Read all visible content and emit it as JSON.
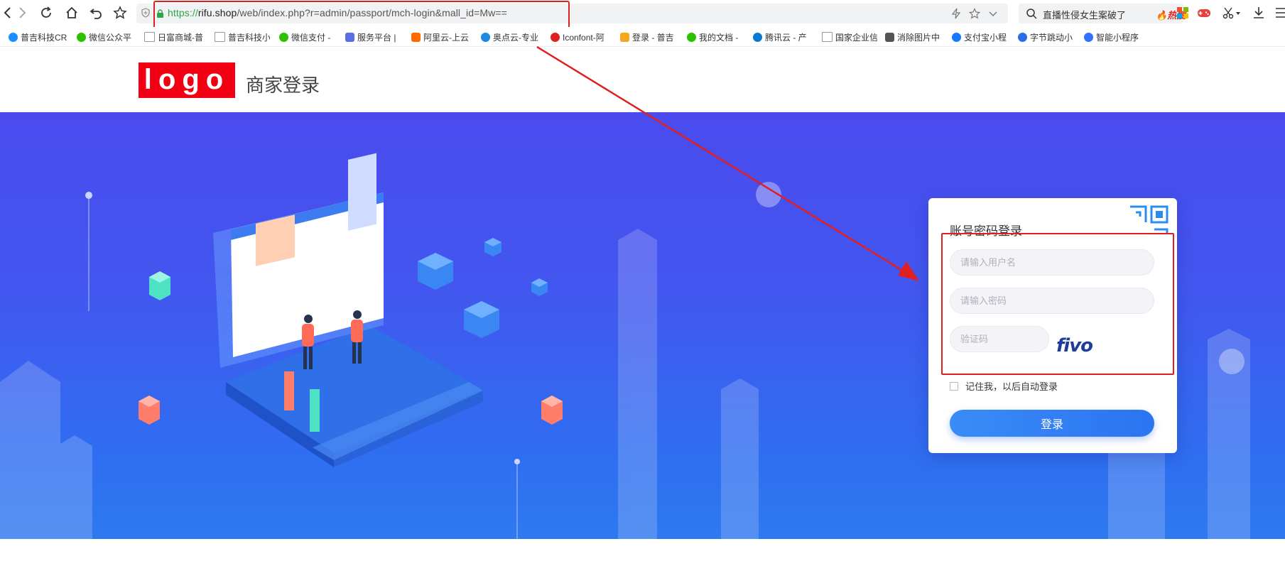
{
  "browser": {
    "url_protocol": "https://",
    "url_host": "rifu.shop",
    "url_path": "/web/index.php?r=admin/passport/mch-login&mall_id=Mw==",
    "search_text": "直播性侵女生案破了",
    "search_badge": "🔥热搜"
  },
  "bookmarks": [
    {
      "label": "普吉科技CR",
      "color": "#1890ff"
    },
    {
      "label": "微信公众平",
      "color": "#2dc100"
    },
    {
      "label": "日富商城-普",
      "color": "#999999"
    },
    {
      "label": "普吉科技小",
      "color": "#999999"
    },
    {
      "label": "微信支付 -",
      "color": "#2dc100"
    },
    {
      "label": "服务平台 |",
      "color": "#5b6ee1"
    },
    {
      "label": "阿里云-上云",
      "color": "#ff6a00"
    },
    {
      "label": "奥点云-专业",
      "color": "#1e88e5"
    },
    {
      "label": "Iconfont-阿",
      "color": "#e02020"
    },
    {
      "label": "登录 - 普吉",
      "color": "#f5a623"
    },
    {
      "label": "我的文档 -",
      "color": "#2dc100"
    },
    {
      "label": "腾讯云 - 产",
      "color": "#0a78d2"
    },
    {
      "label": "国家企业信",
      "color": "#999999"
    },
    {
      "label": "消除图片中",
      "color": "#555555"
    },
    {
      "label": "支付宝小程",
      "color": "#1677ff"
    },
    {
      "label": "字节跳动小",
      "color": "#2b6de3"
    },
    {
      "label": "智能小程序",
      "color": "#3071ff"
    }
  ],
  "header": {
    "logo_text": "logo",
    "title": "商家登录"
  },
  "login": {
    "title": "账号密码登录",
    "username_placeholder": "请输入用户名",
    "password_placeholder": "请输入密码",
    "captcha_placeholder": "验证码",
    "captcha_image_text": "fivo",
    "remember_label": "记住我，以后自动登录",
    "submit_label": "登录"
  },
  "colors": {
    "annotation": "#e02020",
    "logo_bg": "#f10013",
    "accent": "#2b74f2"
  }
}
